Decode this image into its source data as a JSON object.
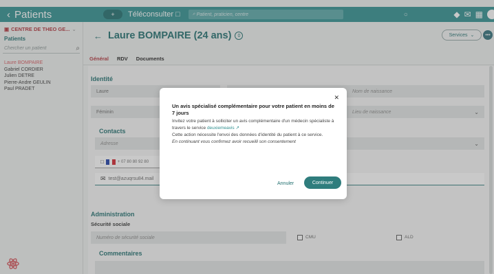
{
  "topbar": {
    "back_label": "Patients",
    "teleconsult_label": "Téléconsulter",
    "search_placeholder": "Patient, praticien, centre"
  },
  "sidebar": {
    "org_name": "CENTRE DE THEO GE...",
    "section_title": "Patients",
    "search_placeholder": "Chercher un patient",
    "patients": [
      {
        "name": "Laure BOMPAIRE",
        "active": true
      },
      {
        "name": "Gabriel CORDIER",
        "active": false
      },
      {
        "name": "Julien DETRE",
        "active": false
      },
      {
        "name": "Pierre-Andre GEULIN",
        "active": false
      },
      {
        "name": "Paul PRADET",
        "active": false
      }
    ]
  },
  "header": {
    "patient_title": "Laure BOMPAIRE (24 ans)",
    "badge": "0",
    "services_label": "Services"
  },
  "tabs": {
    "general": "Général",
    "rdv": "RDV",
    "documents": "Documents"
  },
  "form": {
    "identity_title": "Identité",
    "firstname_value": "Laure",
    "birthname_placeholder": "Nom de naissance",
    "gender_value": "Féminin",
    "birthplace_placeholder": "Lieu de naissance",
    "contacts_title": "Contacts",
    "address_placeholder": "Adresse",
    "phone_value": "+ 07 80 80 92 80",
    "email_value": "test@azuqrsu84.mail",
    "admin_title": "Administration",
    "social_security_label": "Sécurité sociale",
    "social_security_placeholder": "Numéro de sécurité sociale",
    "cmu_label": "CMU",
    "ald_label": "ALD",
    "comments_title": "Commentaires"
  },
  "modal": {
    "title": "Un avis spécialisé complémentaire pour votre patient en moins de 7 jours",
    "body_1": "Invitez votre patient à solliciter un avis complémentaire d'un médecin spécialiste à travers le service",
    "link_label": "deuxiemeavis",
    "body_2": "Cette action nécessite l'envoi des données d'identité du patient à ce service.",
    "body_3": "En continuant vous confirmez avoir recueilli son consentement",
    "cancel_label": "Annuler",
    "continue_label": "Continuer"
  }
}
